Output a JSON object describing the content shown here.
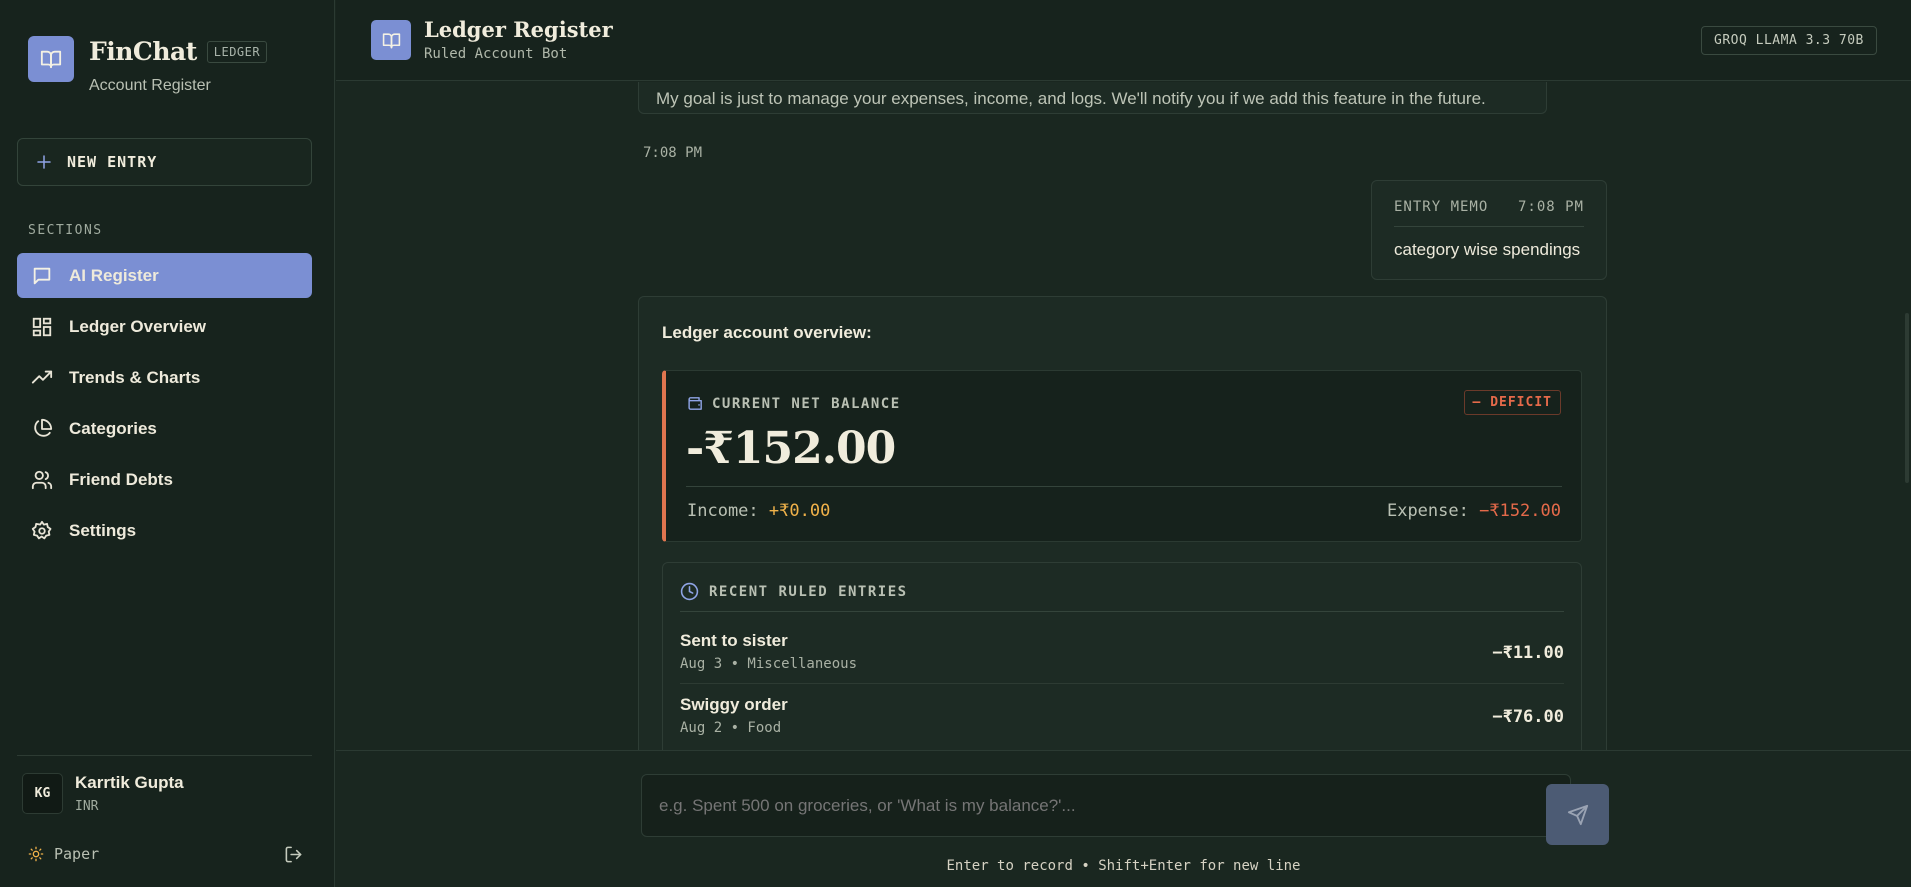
{
  "brand": {
    "title": "FinChat",
    "tag": "LEDGER",
    "subtitle": "Account Register"
  },
  "sidebar": {
    "new_entry_label": "NEW ENTRY",
    "sections_label": "SECTIONS",
    "items": [
      {
        "label": "AI Register",
        "icon": "chat-bubble-icon",
        "active": true
      },
      {
        "label": "Ledger Overview",
        "icon": "grid-icon",
        "active": false
      },
      {
        "label": "Trends & Charts",
        "icon": "trend-up-icon",
        "active": false
      },
      {
        "label": "Categories",
        "icon": "pie-chart-icon",
        "active": false
      },
      {
        "label": "Friend Debts",
        "icon": "users-icon",
        "active": false
      },
      {
        "label": "Settings",
        "icon": "gear-icon",
        "active": false
      }
    ],
    "user": {
      "initials": "KG",
      "name": "Karrtik Gupta",
      "currency": "INR"
    },
    "theme_label": "Paper"
  },
  "header": {
    "title": "Ledger Register",
    "subtitle": "Ruled Account Bot",
    "model": "GROQ LLAMA 3.3 70B"
  },
  "chat": {
    "bot_message": "My goal is just to manage your expenses, income, and logs. We'll notify you if we add this feature in the future.",
    "bot_time": "7:08 PM",
    "user_memo_label": "ENTRY MEMO",
    "user_time": "7:08 PM",
    "user_message": "category wise spendings",
    "overview": {
      "title": "Ledger account overview:",
      "balance_label": "CURRENT NET BALANCE",
      "status_badge": "— DEFICIT",
      "balance": "-₹152.00",
      "income_label": "Income:",
      "income_value": "+₹0.00",
      "expense_label": "Expense:",
      "expense_value": "−₹152.00",
      "recent_label": "RECENT RULED ENTRIES",
      "entries": [
        {
          "name": "Sent to sister",
          "meta": "Aug 3 • Miscellaneous",
          "amount": "−₹11.00"
        },
        {
          "name": "Swiggy order",
          "meta": "Aug 2 • Food",
          "amount": "−₹76.00"
        }
      ]
    }
  },
  "composer": {
    "placeholder": "e.g. Spent 500 on groceries, or 'What is my balance?'...",
    "hint": "Enter to record • Shift+Enter for new line"
  },
  "colors": {
    "accent": "#7b8fd3",
    "background": "#1a2720",
    "deficit": "#e56a4a",
    "income": "#f0b24a"
  }
}
